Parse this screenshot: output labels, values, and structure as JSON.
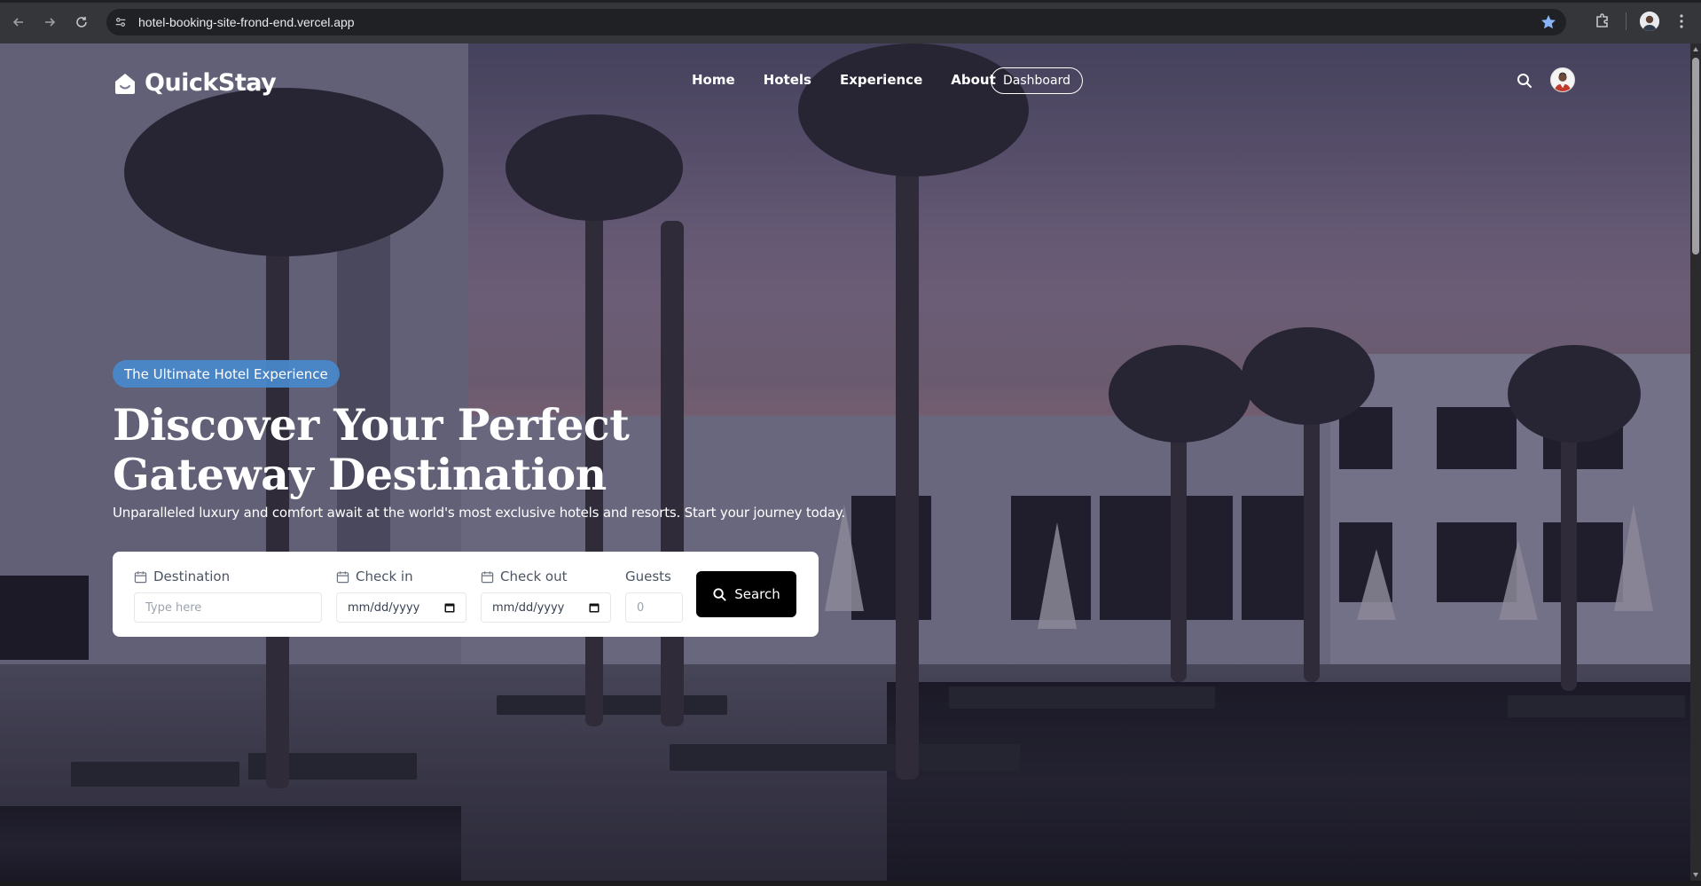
{
  "browser": {
    "url": "hotel-booking-site-frond-end.vercel.app"
  },
  "nav": {
    "brand": "QuickStay",
    "links": [
      "Home",
      "Hotels",
      "Experience",
      "About"
    ],
    "dashboard_label": "Dashboard"
  },
  "hero": {
    "badge": "The Ultimate Hotel Experience",
    "title_line1": "Discover Your Perfect",
    "title_line2": "Gateway Destination",
    "subtitle": "Unparalleled luxury and comfort await at the world's most exclusive hotels and resorts. Start your journey today."
  },
  "search_form": {
    "destination_label": "Destination",
    "destination_placeholder": "Type here",
    "checkin_label": "Check in",
    "checkin_placeholder": "mm/dd/yyyy",
    "checkout_label": "Check out",
    "checkout_placeholder": "mm/dd/yyyy",
    "guests_label": "Guests",
    "guests_placeholder": "0",
    "search_label": "Search"
  },
  "colors": {
    "badge_bg": "#4989cd",
    "search_button_bg": "#000000",
    "chrome_bg": "#35363a",
    "bookmark_star": "#8ab4f8"
  }
}
